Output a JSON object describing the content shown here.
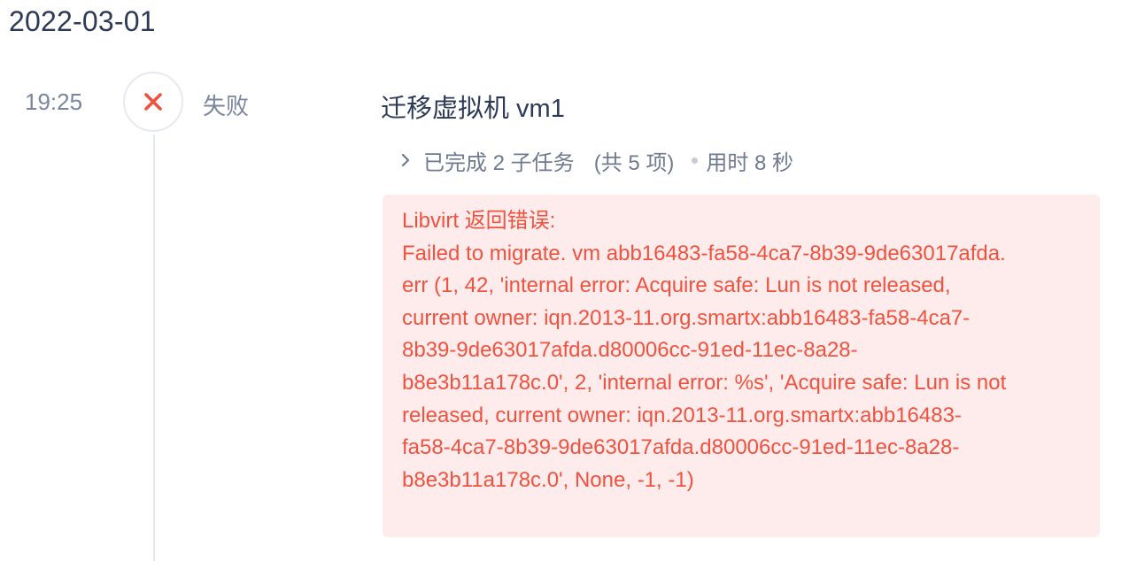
{
  "date": "2022-03-01",
  "entry": {
    "time": "19:25",
    "status_icon": "close-x-icon",
    "status_color": "#f0523f",
    "status_label": "失败",
    "title": "迁移虚拟机 vm1",
    "subtasks": {
      "completed": "已完成 2 子任务",
      "total": "(共 5 项)",
      "duration": "用时 8 秒"
    },
    "error": {
      "background": "#fdeceb",
      "lines": [
        "Libvirt 返回错误:",
        "Failed to migrate. vm abb16483-fa58-4ca7-8b39-9de63017afda.",
        "err (1, 42, 'internal error: Acquire safe: Lun is not released,",
        "current owner: iqn.2013-11.org.smartx:abb16483-fa58-4ca7-",
        "8b39-9de63017afda.d80006cc-91ed-11ec-8a28-",
        "b8e3b11a178c.0', 2, 'internal error: %s', 'Acquire safe: Lun is not",
        "released, current owner: iqn.2013-11.org.smartx:abb16483-",
        "fa58-4ca7-8b39-9de63017afda.d80006cc-91ed-11ec-8a28-",
        "b8e3b11a178c.0', None, -1, -1)"
      ]
    }
  }
}
